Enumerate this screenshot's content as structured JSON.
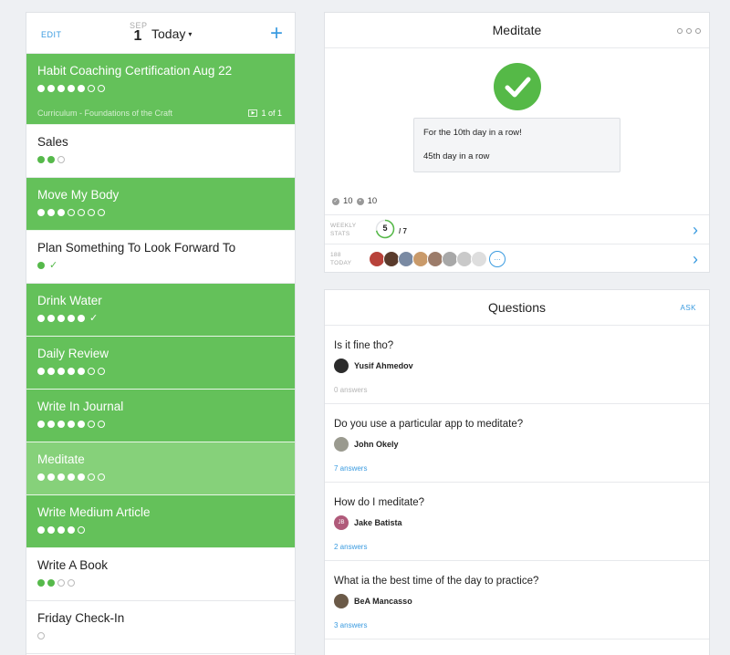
{
  "left_panel": {
    "edit_label": "EDIT",
    "date_month": "SEP",
    "date_day": "1",
    "today_label": "Today",
    "caret": "▾",
    "add_icon": "+",
    "habits": [
      {
        "name": "Habit Coaching Certification Aug 22",
        "style": "green",
        "dots": [
          "f",
          "f",
          "f",
          "f",
          "f",
          "e",
          "e"
        ],
        "check": "",
        "sub_left": "Curriculum - Foundations of the Craft",
        "sub_right": "1 of 1"
      },
      {
        "name": "Sales",
        "style": "white",
        "dots": [
          "f",
          "f",
          "e"
        ],
        "check": ""
      },
      {
        "name": "Move My Body",
        "style": "green",
        "dots": [
          "f",
          "f",
          "f",
          "e",
          "e",
          "e",
          "e"
        ],
        "check": ""
      },
      {
        "name": "Plan Something To Look Forward To",
        "style": "white",
        "dots": [
          "f"
        ],
        "check": "✓"
      },
      {
        "name": "Drink Water",
        "style": "green",
        "dots": [
          "f",
          "f",
          "f",
          "f",
          "f"
        ],
        "check": "✓"
      },
      {
        "name": "Daily Review",
        "style": "green",
        "dots": [
          "f",
          "f",
          "f",
          "f",
          "f",
          "e",
          "e"
        ],
        "check": ""
      },
      {
        "name": "Write In Journal",
        "style": "green",
        "dots": [
          "f",
          "f",
          "f",
          "f",
          "f",
          "e",
          "e"
        ],
        "check": ""
      },
      {
        "name": "Meditate",
        "style": "light",
        "dots": [
          "f",
          "f",
          "f",
          "f",
          "f",
          "e",
          "e"
        ],
        "check": ""
      },
      {
        "name": "Write Medium Article",
        "style": "green",
        "dots": [
          "f",
          "f",
          "f",
          "f",
          "e"
        ],
        "check": ""
      },
      {
        "name": "Write A Book",
        "style": "white",
        "dots": [
          "f",
          "f",
          "e",
          "e"
        ],
        "check": ""
      },
      {
        "name": "Friday Check-In",
        "style": "white",
        "dots": [
          "e"
        ],
        "check": ""
      }
    ]
  },
  "detail": {
    "title": "Meditate",
    "message_line1": "For the 10th day in a row!",
    "message_line2": "45th day in a row",
    "count_a": "10",
    "count_b": "10",
    "weekly_label_1": "WEEKLY",
    "weekly_label_2": "STATS",
    "weekly_value": "5",
    "weekly_total": "/ 7",
    "weekly_fraction": 0.714,
    "today_count_label": "188",
    "today_label": "TODAY",
    "avatar_colors": [
      "#b8423a",
      "#5a3b2c",
      "#7a8aa3",
      "#c99a6a",
      "#9c7c6a",
      "#a8a8a8",
      "#c9c9c9",
      "#dedede"
    ],
    "more_avatars": "…"
  },
  "questions": {
    "title": "Questions",
    "ask_label": "ASK",
    "items": [
      {
        "text": "Is it fine tho?",
        "author": "Yusif Ahmedov",
        "answers": "0 answers",
        "avatar_color": "#2b2b2b",
        "avatar_initials": "",
        "zero": true
      },
      {
        "text": "Do you use a particular app to meditate?",
        "author": "John Okely",
        "answers": "7 answers",
        "avatar_color": "#9a9a8f",
        "avatar_initials": "",
        "zero": false
      },
      {
        "text": "How do I meditate?",
        "author": "Jake Batista",
        "answers": "2 answers",
        "avatar_color": "#b05a7a",
        "avatar_initials": "JB",
        "zero": false
      },
      {
        "text": "What ia the best time of the day to practice?",
        "author": "BeA Mancasso",
        "answers": "3 answers",
        "avatar_color": "#6b5a48",
        "avatar_initials": "",
        "zero": false
      }
    ]
  }
}
